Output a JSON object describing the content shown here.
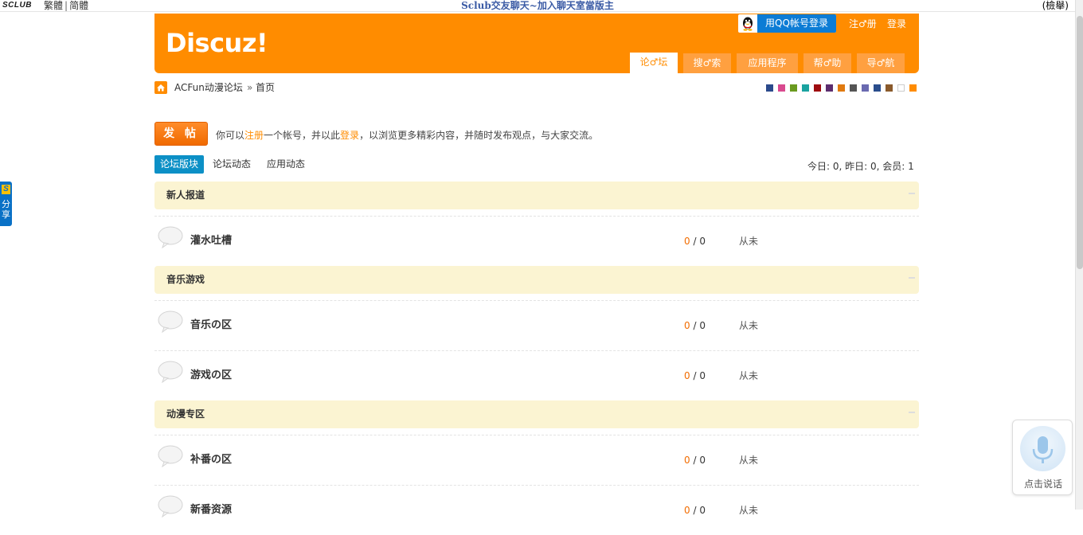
{
  "topbar": {
    "logo_text": "SCLUB",
    "lang_traditional": "繁體",
    "lang_separator": "|",
    "lang_simplified": "简體",
    "slogan": "Sclub交友聊天~加入聊天室當版主",
    "right_link": "(檢舉)"
  },
  "header": {
    "logo": "Discuz!",
    "qq_login": "用QQ帐号登录",
    "register": "注♂册",
    "login": "登录",
    "nav": [
      {
        "label": "论♂坛",
        "active": true
      },
      {
        "label": "搜♂索",
        "active": false
      },
      {
        "label": "应用程序",
        "active": false
      },
      {
        "label": "帮♂助",
        "active": false
      },
      {
        "label": "导♂航",
        "active": false
      }
    ]
  },
  "breadcrumb": {
    "site": "ACFun动漫论坛",
    "separator": "»",
    "page": "首页"
  },
  "theme_swatches": [
    "#2b4a8c",
    "#d94a8f",
    "#6a9a1f",
    "#1aa3a0",
    "#9e0b0f",
    "#5c2d6e",
    "#e07a10",
    "#555555",
    "#6a6ab0",
    "#2a4d8c",
    "#8a5a2b",
    "#ffffff",
    "#ff8c00"
  ],
  "post_button": "发 帖",
  "notice": {
    "prefix": "你可以",
    "register_link": "注册",
    "middle": "一个帐号，并以此",
    "login_link": "登录",
    "suffix": "，以浏览更多精彩内容，并随时发布观点，与大家交流。"
  },
  "tabs": [
    {
      "label": "论坛版块",
      "active": true
    },
    {
      "label": "论坛动态",
      "active": false
    },
    {
      "label": "应用动态",
      "active": false
    }
  ],
  "stats": "今日: 0, 昨日: 0, 会员: 1",
  "categories": [
    {
      "title": "新人报道",
      "forums": [
        {
          "name": "灌水吐槽",
          "today": "0",
          "total": "0",
          "last": "从未"
        }
      ]
    },
    {
      "title": "音乐游戏",
      "forums": [
        {
          "name": "音乐の区",
          "today": "0",
          "total": "0",
          "last": "从未"
        },
        {
          "name": "游戏の区",
          "today": "0",
          "total": "0",
          "last": "从未"
        }
      ]
    },
    {
      "title": "动漫专区",
      "forums": [
        {
          "name": "补番の区",
          "today": "0",
          "total": "0",
          "last": "从未"
        },
        {
          "name": "新番资源",
          "today": "0",
          "total": "0",
          "last": "从未"
        }
      ]
    }
  ],
  "share_tab": {
    "logo": "S",
    "text": "分享"
  },
  "voice_widget": {
    "label": "点击说话"
  }
}
